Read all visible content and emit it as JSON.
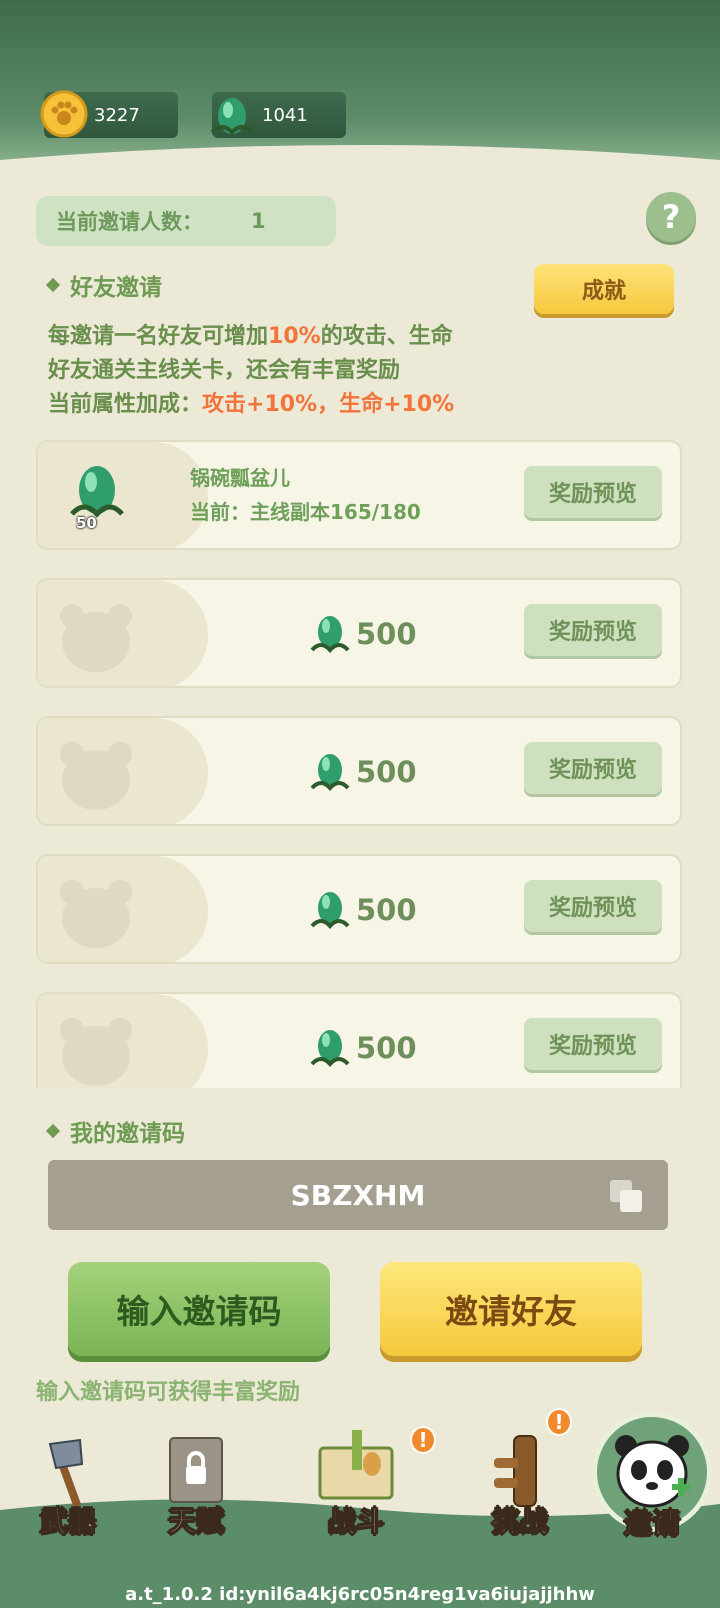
{
  "resources": {
    "coins": "3227",
    "gems": "1041"
  },
  "invite_count": {
    "label": "当前邀请人数：",
    "value": "1"
  },
  "help": {
    "label": "?"
  },
  "friend_invite": {
    "title": "好友邀请",
    "achievement_button": "成就",
    "line1_a": "每邀请一名好友可增加",
    "line1_hl": "10%",
    "line1_b": "的攻击、生命",
    "line2": "好友通关主线关卡，还会有丰富奖励",
    "line3_a": "当前属性加成：",
    "line3_hl": "攻击+10%，生命+10%"
  },
  "cards": [
    {
      "friend_name": "锅碗瓢盆儿",
      "progress": "当前：主线副本165/180",
      "badge": "50",
      "preview": "奖励预览"
    },
    {
      "reward": "500",
      "preview": "奖励预览"
    },
    {
      "reward": "500",
      "preview": "奖励预览"
    },
    {
      "reward": "500",
      "preview": "奖励预览"
    },
    {
      "reward": "500",
      "preview": "奖励预览"
    }
  ],
  "my_code": {
    "title": "我的邀请码",
    "code": "SBZXHM"
  },
  "buttons": {
    "enter_code": "输入邀请码",
    "invite_friends": "邀请好友"
  },
  "hint": "输入邀请码可获得丰富奖励",
  "nav": {
    "weapon": "武器",
    "talent": "天赋",
    "battle": "战斗",
    "challenge": "挑战",
    "invite": "邀请",
    "badge": "!"
  },
  "version": "a.t_1.0.2 id:ynil6a4kj6rc05n4reg1va6iujajjhhw",
  "colors": {
    "accent_green": "#6e9a52",
    "highlight_orange": "#f2743a",
    "gold": "#f7c83d"
  }
}
